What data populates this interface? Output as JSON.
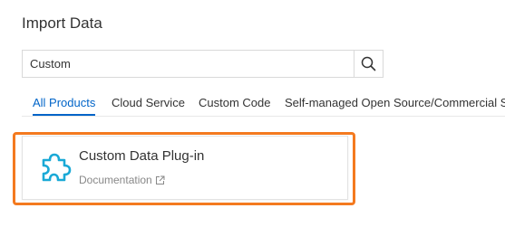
{
  "page": {
    "title": "Import Data"
  },
  "search": {
    "value": "Custom",
    "icon": "search-icon"
  },
  "tabs": [
    {
      "label": "All Products",
      "active": true
    },
    {
      "label": "Cloud Service",
      "active": false
    },
    {
      "label": "Custom Code",
      "active": false
    },
    {
      "label": "Self-managed Open Source/Commercial Software",
      "active": false
    }
  ],
  "results": [
    {
      "title": "Custom Data Plug-in",
      "link_label": "Documentation",
      "icon": "puzzle-plugin-icon",
      "link_icon": "external-link-icon"
    }
  ],
  "colors": {
    "accent": "#0064c8",
    "highlight_border": "#f47a1f",
    "plugin_icon": "#1aa9d6"
  }
}
